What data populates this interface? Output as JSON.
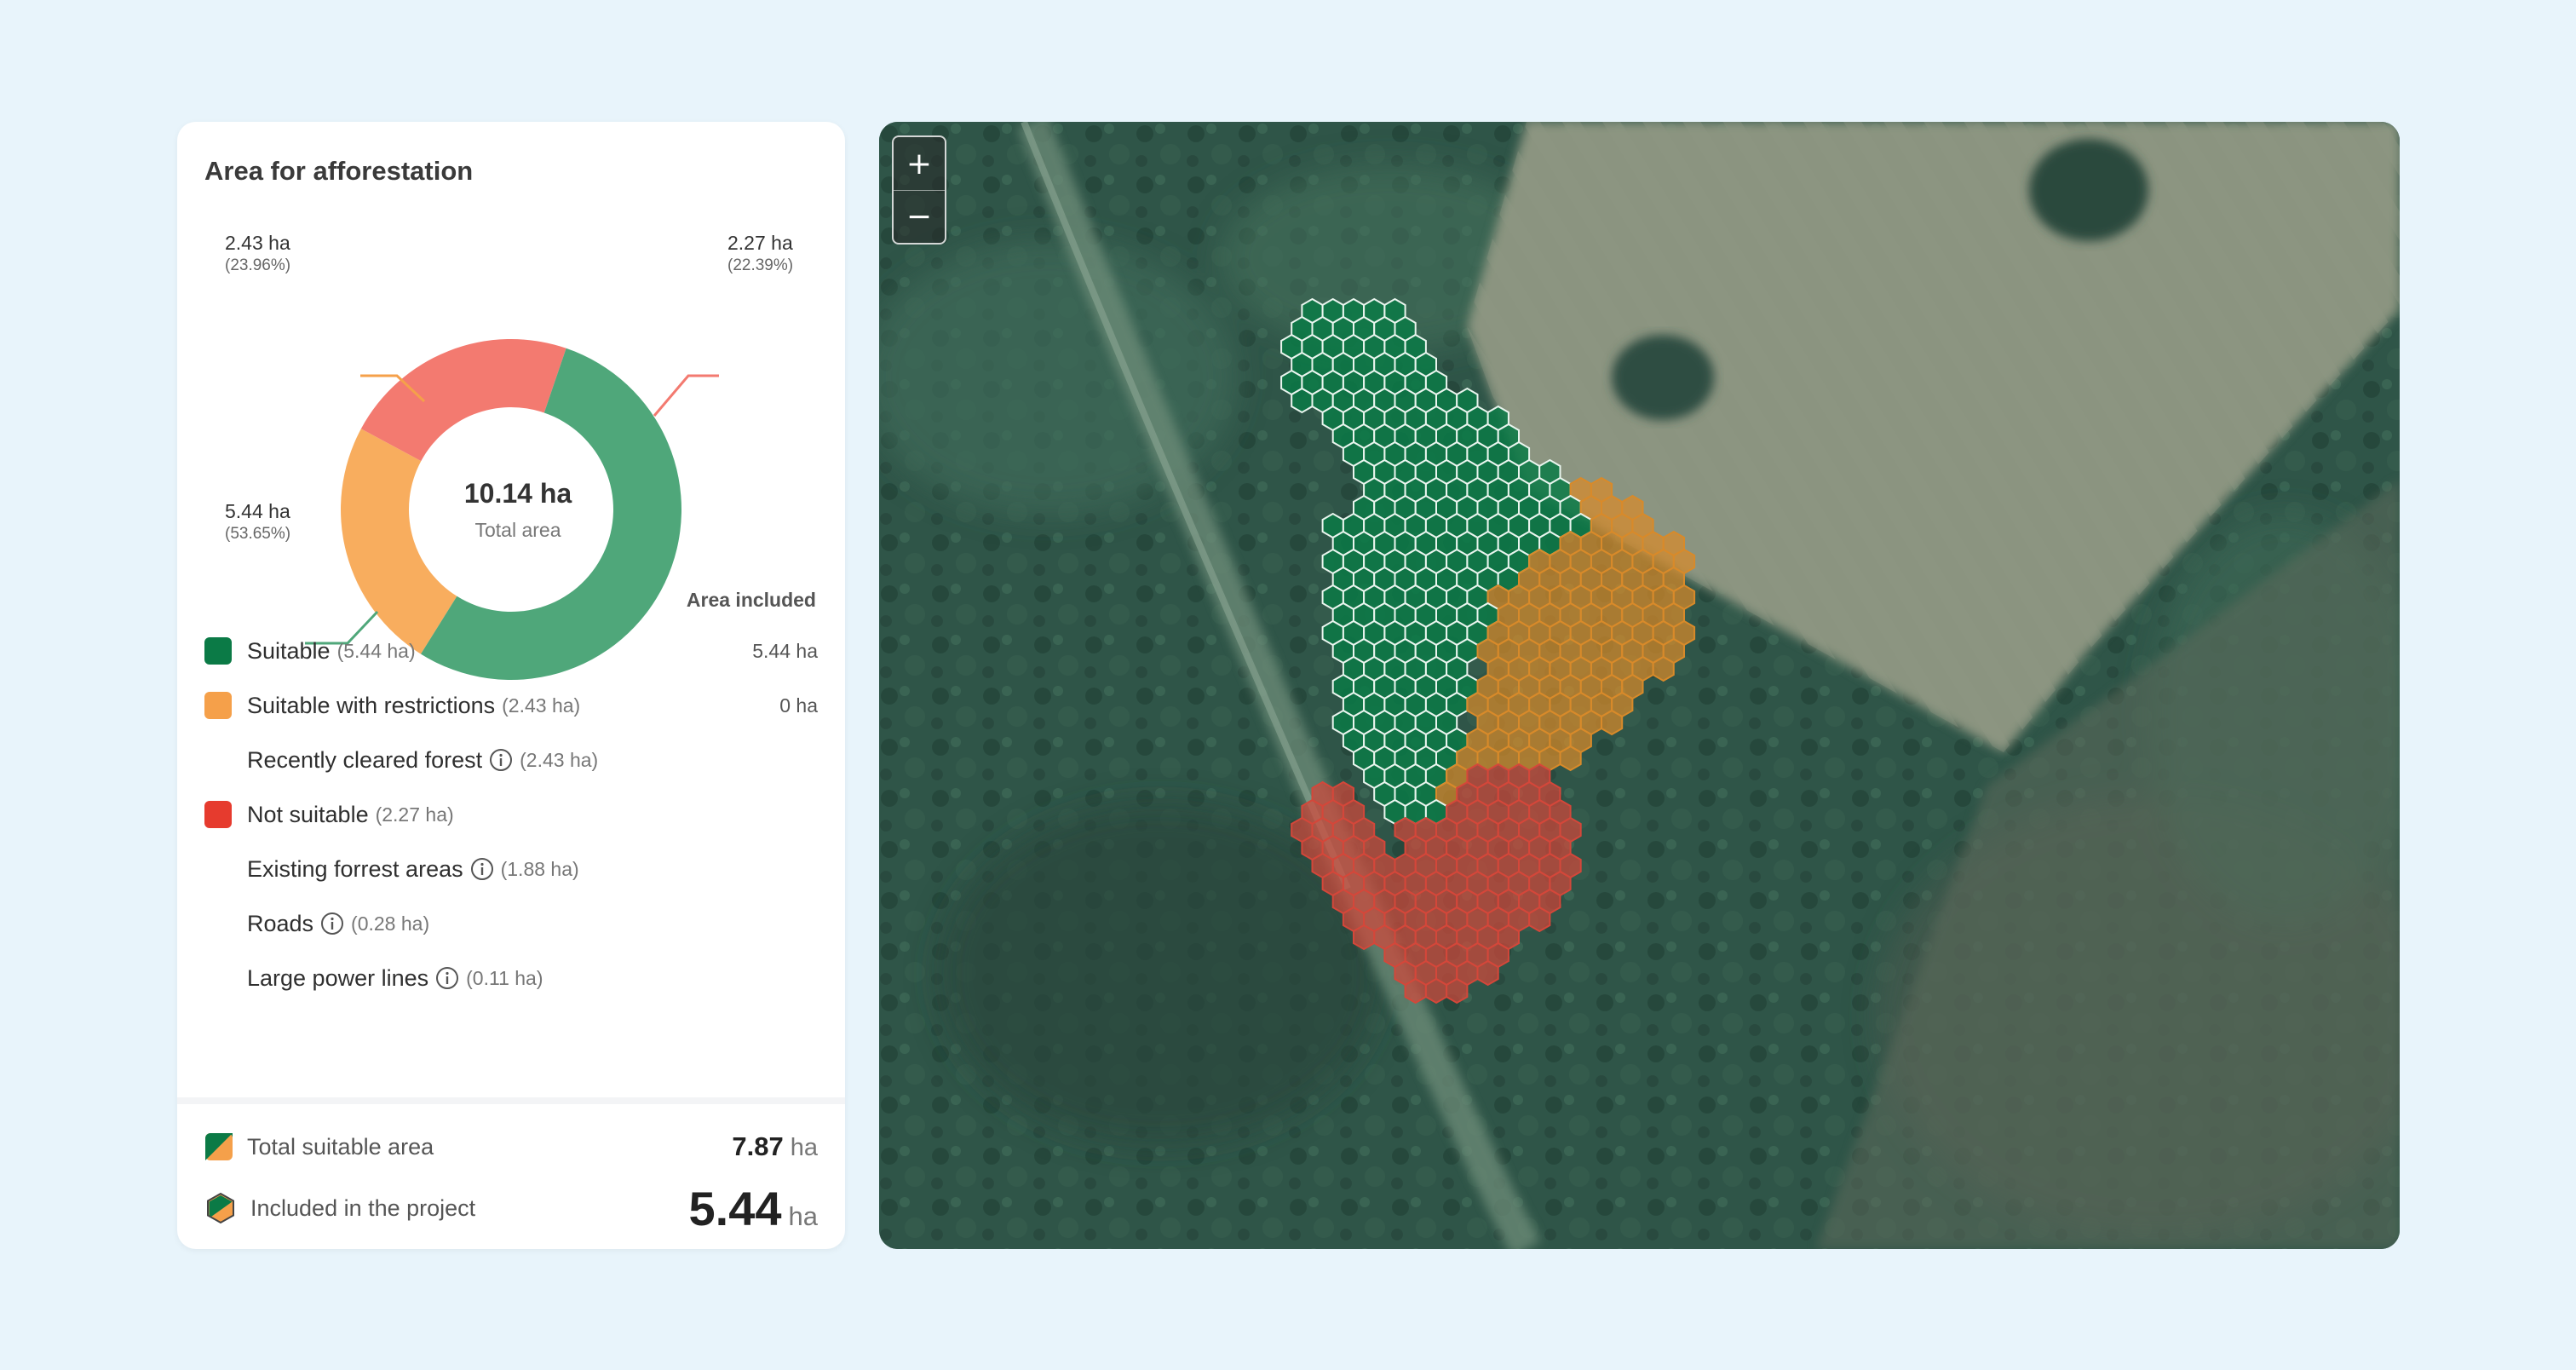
{
  "panel": {
    "title": "Area for afforestation",
    "center_value": "10.14 ha",
    "center_label": "Total area",
    "callouts": {
      "orange": {
        "value": "2.43 ha",
        "pct": "(23.96%)"
      },
      "red": {
        "value": "2.27 ha",
        "pct": "(22.39%)"
      },
      "green": {
        "value": "5.44 ha",
        "pct": "(53.65%)"
      }
    },
    "column_header": "Area included",
    "legend": [
      {
        "label": "Suitable",
        "sub": "(5.44 ha)",
        "amount": "5.44 ha",
        "color": "#0b7a46"
      },
      {
        "label": "Suitable with restrictions",
        "sub": "(2.43 ha)",
        "amount": "0 ha",
        "color": "#f5a04a"
      },
      {
        "label": "Recently cleared forest",
        "sub": "(2.43 ha)"
      },
      {
        "label": "Not suitable",
        "sub": "(2.27 ha)",
        "color": "#e63b2e"
      },
      {
        "label": "Existing forrest areas",
        "sub": "(1.88 ha)"
      },
      {
        "label": "Roads",
        "sub": "(0.28 ha)"
      },
      {
        "label": "Large power lines",
        "sub": "(0.11 ha)"
      }
    ],
    "footer": {
      "total_label": "Total suitable area",
      "total_value": "7.87",
      "total_unit": "ha",
      "included_label": "Included in the project",
      "included_value": "5.44",
      "included_unit": "ha"
    }
  },
  "chart_data": {
    "type": "pie",
    "categories": [
      "Suitable",
      "Suitable with restrictions",
      "Not suitable"
    ],
    "values": [
      5.44,
      2.43,
      2.27
    ],
    "percent": [
      53.65,
      23.96,
      22.39
    ],
    "colors": [
      "#4fa77a",
      "#f8ad5e",
      "#f37a70"
    ],
    "title": "Area for afforestation"
  },
  "map": {
    "zoom_in": "+",
    "zoom_out": "−",
    "hex_colors": {
      "suitable": "#0b7a46",
      "restricted": "#d88a2a",
      "not_suitable": "#d4473a"
    }
  }
}
